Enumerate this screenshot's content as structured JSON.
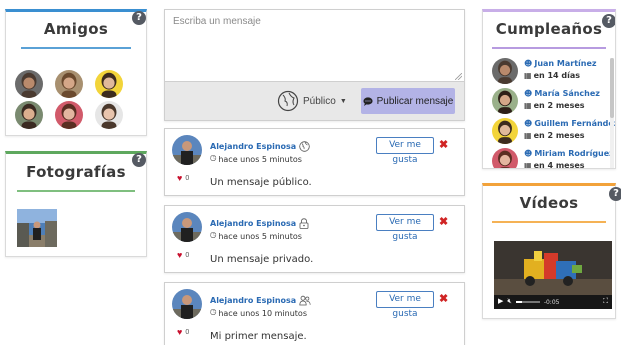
{
  "amigos": {
    "title": "Amigos",
    "friends": [
      {
        "name": "friend-1",
        "skin": "#b98a6c",
        "hair": "#4a3a30",
        "bg": "#6b6b6b"
      },
      {
        "name": "friend-2",
        "skin": "#d4a788",
        "hair": "#6b4a2e",
        "bg": "#a89070"
      },
      {
        "name": "friend-3",
        "skin": "#e0b99a",
        "hair": "#3d2c1e",
        "bg": "#f2d43a"
      },
      {
        "name": "friend-4",
        "skin": "#dcae8f",
        "hair": "#3b2a22",
        "bg": "#7a8a70"
      },
      {
        "name": "friend-5",
        "skin": "#e3b6a0",
        "hair": "#5a2e22",
        "bg": "#d15a6a"
      },
      {
        "name": "friend-6",
        "skin": "#e8c4ad",
        "hair": "#4a382c",
        "bg": "#e6e6e6"
      }
    ]
  },
  "fotografias": {
    "title": "Fotografías"
  },
  "composer": {
    "placeholder": "Escriba un mensaje",
    "privacy_label": "Público",
    "publish_label": "Publicar mensaje"
  },
  "posts": [
    {
      "author": "Alejandro Espinosa",
      "time": "hace unos 5 minutos",
      "likes": "0",
      "message": "Un mensaje público.",
      "likes_button": "Ver me gusta",
      "privacy_icon": "globe-icon"
    },
    {
      "author": "Alejandro Espinosa",
      "time": "hace unos 5 minutos",
      "likes": "0",
      "message": "Un mensaje privado.",
      "likes_button": "Ver me gusta",
      "privacy_icon": "lock-icon"
    },
    {
      "author": "Alejandro Espinosa",
      "time": "hace unos 10 minutos",
      "likes": "0",
      "message": "Mi primer mensaje.",
      "likes_button": "Ver me gusta",
      "privacy_icon": "users-icon"
    }
  ],
  "cumpleanos": {
    "title": "Cumpleaños",
    "items": [
      {
        "name": "Juan Martínez",
        "when": "en 14 días",
        "skin": "#b98a6c",
        "hair": "#4a3a30",
        "bg": "#6b6b6b"
      },
      {
        "name": "María Sánchez",
        "when": "en 2 meses",
        "skin": "#d4a788",
        "hair": "#2e2018",
        "bg": "#9ab08a"
      },
      {
        "name": "Guillem Fernández",
        "when": "en 2 meses",
        "skin": "#e0b99a",
        "hair": "#3d2c1e",
        "bg": "#f2d43a"
      },
      {
        "name": "Miriam Rodríguez",
        "when": "en 4 meses",
        "skin": "#e3b6a0",
        "hair": "#5a2e22",
        "bg": "#d15a6a"
      }
    ]
  },
  "videos": {
    "title": "Vídeos",
    "time": "-0:05",
    "progress": 0.25
  },
  "colors": {
    "link": "#2a6ab3",
    "like": "#c8102e",
    "delete": "#d02424",
    "publish_bg": "#b3b3e6"
  }
}
